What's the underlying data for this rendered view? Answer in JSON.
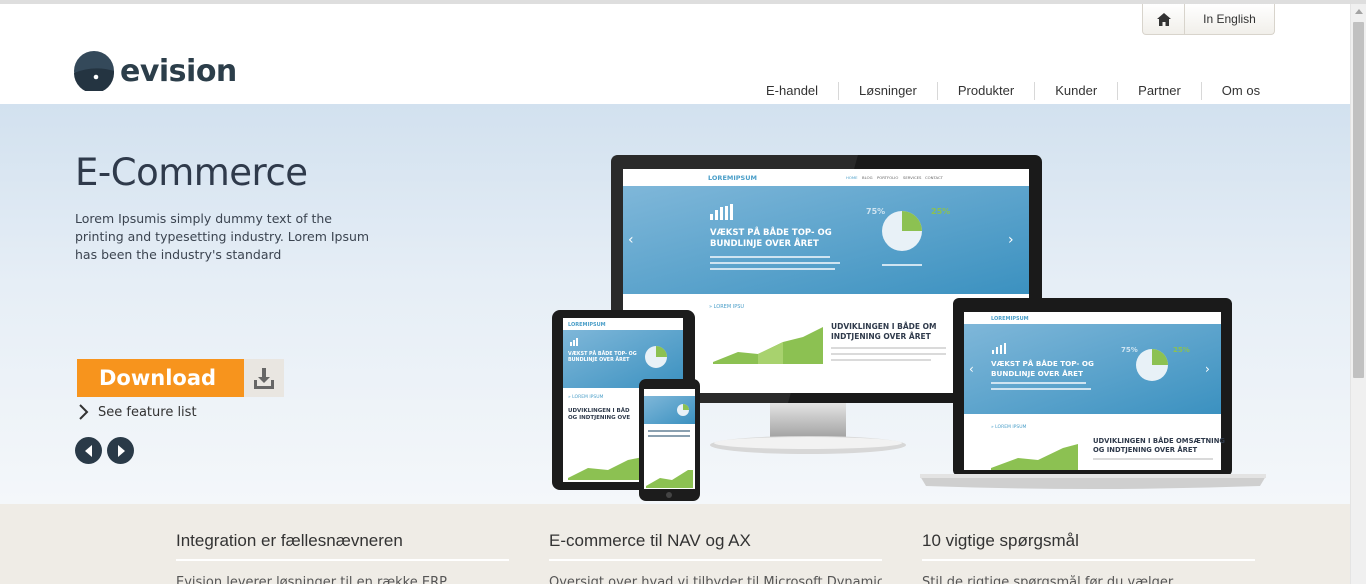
{
  "header": {
    "lang_label": "In English",
    "logo_text": "evision",
    "nav": [
      "E-handel",
      "Løsninger",
      "Produkter",
      "Kunder",
      "Partner",
      "Om os"
    ]
  },
  "hero": {
    "title": "E-Commerce",
    "text": "Lorem Ipsumis simply dummy text of the printing and typesetting industry. Lorem Ipsum has been the industry's standard",
    "download_label": "Download",
    "feature_link": "See feature list"
  },
  "mockup": {
    "brand": "LOREMIPSUM",
    "menu": [
      "HOME",
      "BLOG",
      "PORTFOLIO",
      "SERVICES",
      "CONTACT"
    ],
    "headline_1": "VÆKST PÅ BÅDE TOP- OG",
    "headline_2": "BUNDLINJE OVER ÅRET",
    "pct_left": "75%",
    "pct_right": "25%",
    "section_label": "» LOREM IPSU",
    "section_label_laptop": "» LOREM IPSUM",
    "sub_headline_1": "UDVIKLINGEN I BÅDE OM",
    "sub_headline_2": "INDTJENING OVER ÅRET",
    "laptop_sub_1": "UDVIKLINGEN I BÅDE OMSÆTNING",
    "laptop_sub_2": "OG INDTJENING OVER ÅRET",
    "tablet_sub_1": "UDVIKLINGEN I BÅD",
    "tablet_sub_2": "OG INDTJENING OVE"
  },
  "bottom": {
    "columns": [
      {
        "title": "Integration er fællesnævneren",
        "text": "Evision leverer løsninger til en række ERP"
      },
      {
        "title": "E-commerce til NAV og AX",
        "text": "Oversigt over hvad vi tilbyder til Microsoft Dynamics"
      },
      {
        "title": "10 vigtige spørgsmål",
        "text": "Stil de rigtige spørgsmål før du vælger"
      }
    ]
  },
  "colors": {
    "accent": "#f7941d",
    "dark": "#2a3a48",
    "mock_blue": "#4a9ec8",
    "mock_green": "#8cc152"
  }
}
